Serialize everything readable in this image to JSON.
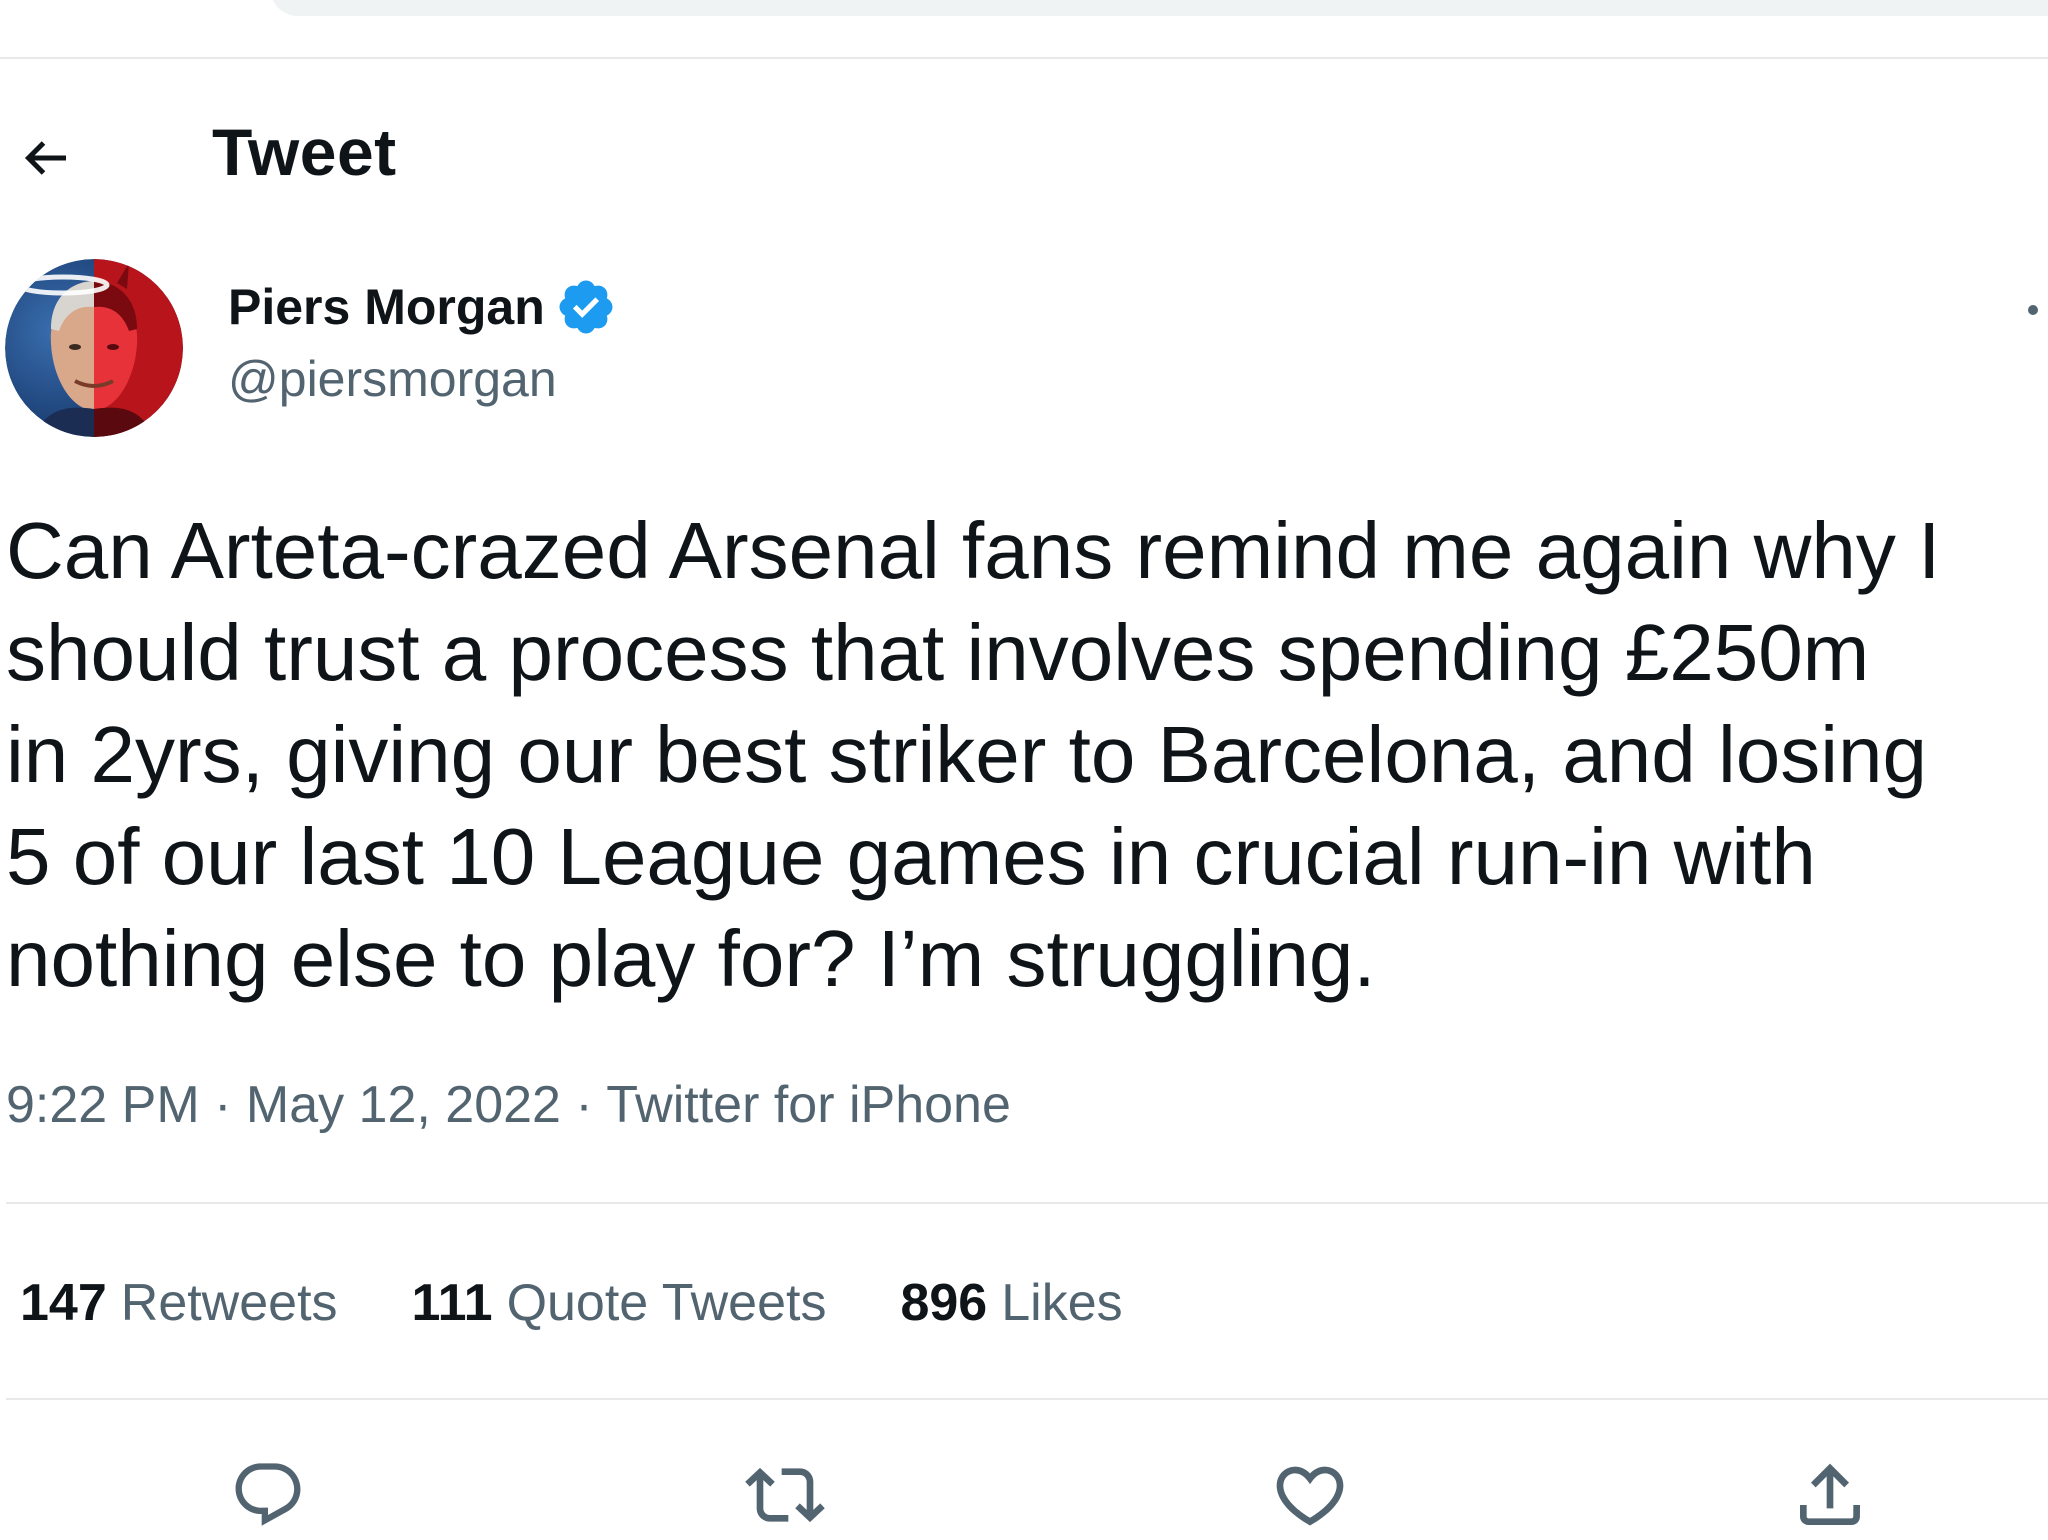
{
  "header": {
    "title": "Tweet"
  },
  "author": {
    "name": "Piers Morgan",
    "handle": "@piersmorgan",
    "verified": true
  },
  "tweet": {
    "lines": [
      "Can Arteta-crazed Arsenal fans remind me again why I",
      "should trust a process that involves spending £250m",
      "in 2yrs, giving our best striker to Barcelona, and losing",
      "5 of our last 10 League games in crucial run-in with",
      "nothing else to play for?  I’m struggling."
    ],
    "time": "9:22 PM",
    "date": "May 12, 2022",
    "source": "Twitter for iPhone",
    "separator": " · "
  },
  "stats": {
    "retweets_count": "147",
    "retweets_label": "Retweets",
    "quotes_count": "111",
    "quotes_label": "Quote Tweets",
    "likes_count": "896",
    "likes_label": "Likes"
  },
  "colors": {
    "text_primary": "#0f1419",
    "text_secondary": "#536471",
    "verified_blue": "#1d9bf0",
    "divider": "#e7e9ea"
  },
  "icons": {
    "back": "arrow-left-icon",
    "verified": "verified-badge-icon",
    "reply": "speech-bubble-icon",
    "retweet": "retweet-arrows-icon",
    "like": "heart-icon",
    "share": "share-upload-icon"
  }
}
